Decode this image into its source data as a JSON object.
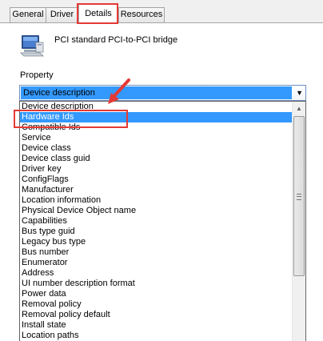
{
  "tabs": [
    {
      "label": "General"
    },
    {
      "label": "Driver"
    },
    {
      "label": "Details",
      "active": true
    },
    {
      "label": "Resources"
    }
  ],
  "device": {
    "icon": "pci-device-icon",
    "name": "PCI standard PCI-to-PCI bridge"
  },
  "property": {
    "label": "Property",
    "selected": "Device description",
    "options": [
      "Device description",
      "Hardware Ids",
      "Compatible Ids",
      "Service",
      "Device class",
      "Device class guid",
      "Driver key",
      "ConfigFlags",
      "Manufacturer",
      "Location information",
      "Physical Device Object name",
      "Capabilities",
      "Bus type guid",
      "Legacy bus type",
      "Bus number",
      "Enumerator",
      "Address",
      "UI number description format",
      "Power data",
      "Removal policy",
      "Removal policy default",
      "Install state",
      "Location paths"
    ],
    "highlighted": "Hardware Ids"
  },
  "annotation_color": "#e53935",
  "highlight_color": "#3399ff"
}
